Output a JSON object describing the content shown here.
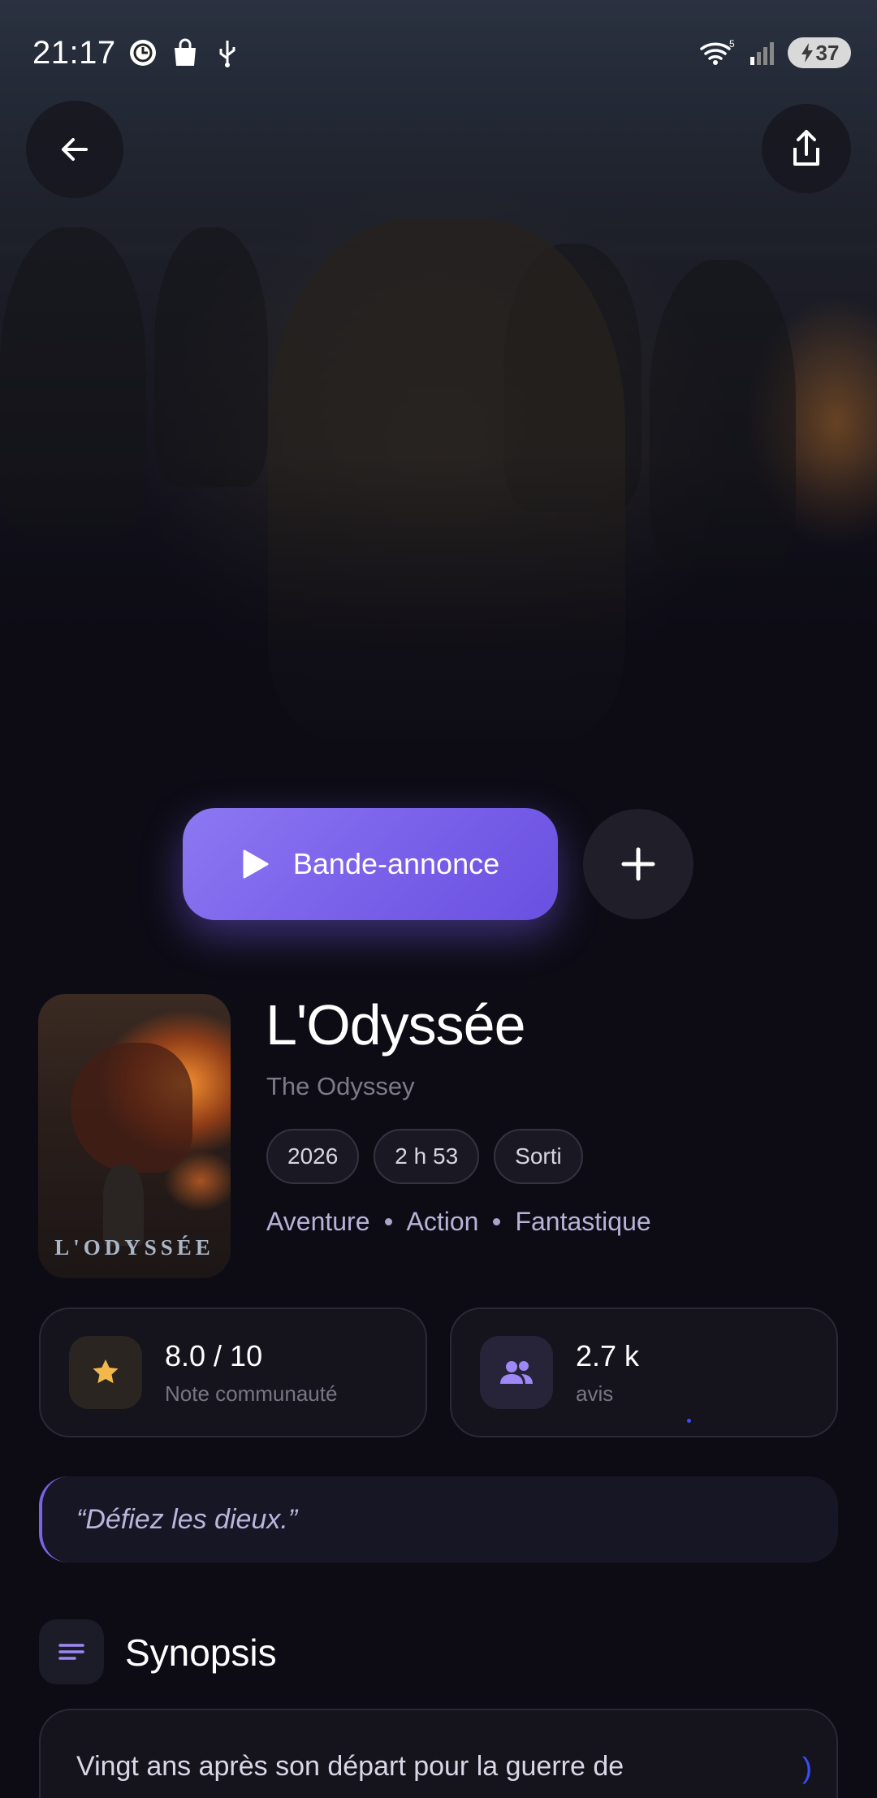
{
  "status_bar": {
    "time": "21:17",
    "icons_left": [
      "world-clock-icon",
      "shopping-bag-icon",
      "usb-icon"
    ],
    "wifi_label": "5",
    "battery": "37"
  },
  "hero": {
    "back_icon": "arrow-left-icon",
    "share_icon": "share-icon"
  },
  "actions": {
    "trailer_label": "Bande-annonce",
    "trailer_icon": "play-icon",
    "add_icon": "plus-icon",
    "accent_color": "#7a62ea"
  },
  "movie": {
    "poster_text": "L'ODYSSÉE",
    "title": "L'Odyssée",
    "original_title": "The Odyssey",
    "chips": [
      "2026",
      "2 h 53",
      "Sorti"
    ],
    "genres": [
      "Aventure",
      "Action",
      "Fantastique"
    ]
  },
  "stats": {
    "rating": {
      "value": "8.0 / 10",
      "label": "Note communauté",
      "icon": "star-icon",
      "color": "#f2b84b"
    },
    "reviews": {
      "value": "2.7 k",
      "label": "avis",
      "icon": "people-icon",
      "color": "#9d88f5"
    }
  },
  "tagline": "“Défiez les dieux.”",
  "synopsis": {
    "heading": "Synopsis",
    "icon": "notes-icon",
    "text": "Vingt ans après son départ pour la guerre de"
  }
}
